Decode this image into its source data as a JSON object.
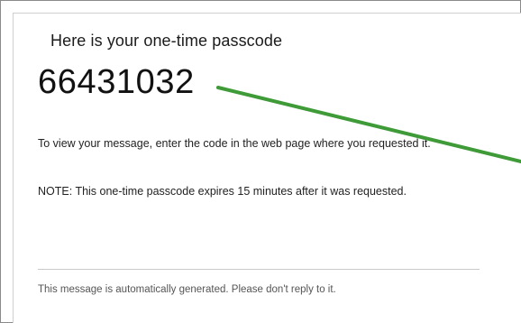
{
  "email": {
    "heading": "Here is your one-time passcode",
    "passcode": "66431032",
    "instruction": "To view your message, enter the code in the web page where you requested it.",
    "note": "NOTE: This one-time passcode expires 15 minutes after it was requested.",
    "footer": "This message is automatically generated. Please don't reply to it."
  },
  "colors": {
    "arrow": "#3f9a38",
    "text": "#222222",
    "muted": "#555555"
  }
}
